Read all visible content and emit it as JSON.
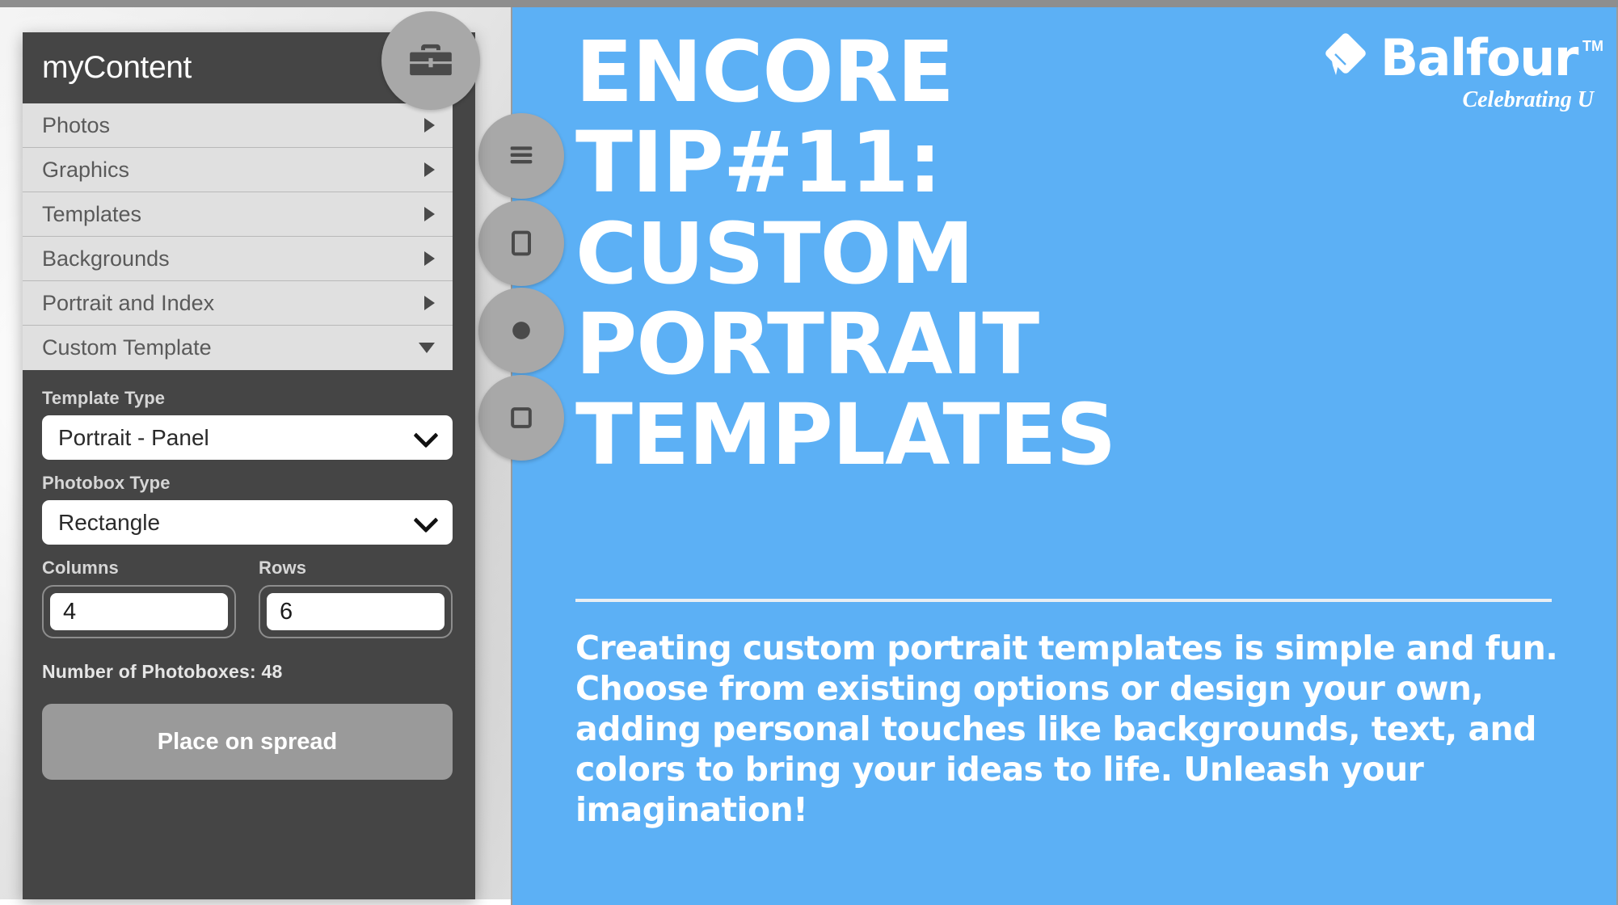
{
  "colors": {
    "slide_blue": "#5CB0F5",
    "panel_dark": "#454545",
    "menu_gray": "#E0E0E0",
    "button_gray": "#9A9A9A",
    "chrome_gray": "#8E8E8E",
    "white": "#FFFFFF"
  },
  "app": {
    "panel": {
      "title": "myContent",
      "briefcase_icon": "briefcase-icon",
      "menu_items": [
        {
          "label": "Photos",
          "caret": "caret-right-icon",
          "expanded": false
        },
        {
          "label": "Graphics",
          "caret": "caret-right-icon",
          "expanded": false
        },
        {
          "label": "Templates",
          "caret": "caret-right-icon",
          "expanded": false
        },
        {
          "label": "Backgrounds",
          "caret": "caret-right-icon",
          "expanded": false
        },
        {
          "label": "Portrait and Index",
          "caret": "caret-right-icon",
          "expanded": false
        },
        {
          "label": "Custom Template",
          "caret": "caret-down-icon",
          "expanded": true
        }
      ],
      "form": {
        "template_type_label": "Template Type",
        "template_type_value": "Portrait - Panel",
        "photobox_type_label": "Photobox Type",
        "photobox_type_value": "Rectangle",
        "columns_label": "Columns",
        "columns_value": "4",
        "rows_label": "Rows",
        "rows_value": "6",
        "photobox_count_text": "Number of Photoboxes: 48",
        "place_button_label": "Place on spread"
      }
    },
    "toolbar_buttons": [
      {
        "name": "layers-icon"
      },
      {
        "name": "page-icon"
      },
      {
        "name": "circle-icon"
      },
      {
        "name": "frame-icon"
      }
    ]
  },
  "slide": {
    "brand": {
      "mark": "balfour-diamond-cap-icon",
      "name": "Balfour",
      "tm": "TM",
      "tagline": "Celebrating U"
    },
    "headline_lines": [
      "ENCORE",
      "TIP#11:",
      "CUSTOM",
      "PORTRAIT",
      "TEMPLATES"
    ],
    "headline_full": "ENCORE TIP#11: CUSTOM PORTRAIT TEMPLATES",
    "body_copy": "Creating custom portrait templates is simple and fun. Choose from existing options or design your own, adding personal touches like backgrounds, text, and colors to bring your ideas to life. Unleash your imagination!"
  }
}
